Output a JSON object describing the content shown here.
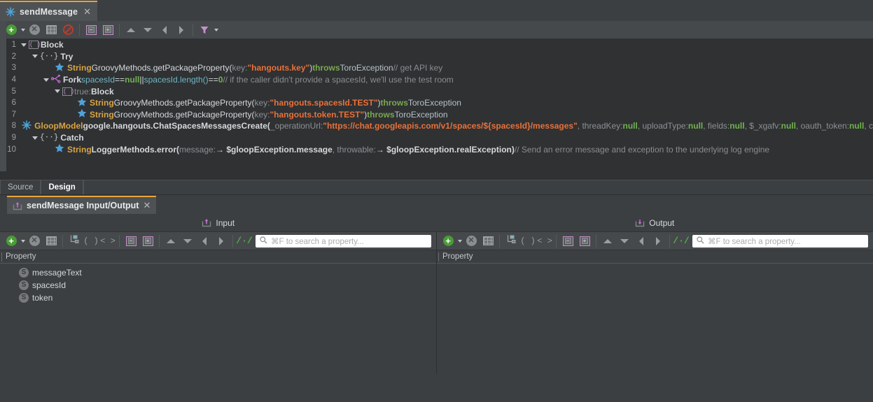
{
  "editor_tab": {
    "title": "sendMessage",
    "icon": "splat-icon",
    "close": "✕"
  },
  "top_toolbar": {
    "buttons": [
      {
        "name": "add-node-button",
        "icon": "green-plus-circle",
        "label": "+"
      },
      {
        "name": "add-node-dropdown",
        "icon": "caret-down-icon"
      },
      {
        "name": "delete-node-button",
        "icon": "grey-x-circle",
        "label": "✕"
      },
      {
        "name": "grid-view-button",
        "icon": "grid-icon"
      },
      {
        "name": "disable-node-button",
        "icon": "ban-icon"
      },
      {
        "name": "collapse-all-button",
        "icon": "collapse-box-icon",
        "label": "−"
      },
      {
        "name": "expand-all-button",
        "icon": "expand-box-icon",
        "label": "+"
      },
      {
        "name": "move-up-button",
        "icon": "triangle-up-icon"
      },
      {
        "name": "move-down-button",
        "icon": "triangle-down-icon"
      },
      {
        "name": "move-left-button",
        "icon": "triangle-left-icon"
      },
      {
        "name": "move-right-button",
        "icon": "triangle-right-icon"
      },
      {
        "name": "filter-button",
        "icon": "funnel-icon"
      },
      {
        "name": "filter-dropdown",
        "icon": "caret-down-icon"
      }
    ]
  },
  "code": {
    "lines": [
      {
        "num": "1",
        "indent": 0,
        "arrow": true,
        "icon": "block-bracket-icon",
        "tokens": [
          {
            "text": "Block",
            "cls": "id bold"
          }
        ]
      },
      {
        "num": "2",
        "indent": 1,
        "arrow": true,
        "icon": "braces-icon",
        "tokens": [
          {
            "text": "Try",
            "cls": "id bold"
          }
        ]
      },
      {
        "num": "3",
        "indent": 3,
        "arrow": false,
        "icon": "star-icon",
        "tokens": [
          {
            "text": "String ",
            "cls": "kw-type bold"
          },
          {
            "text": "GroovyMethods.getPackageProperty(",
            "cls": "id"
          },
          {
            "text": " key:",
            "cls": "param"
          },
          {
            "text": " \"hangouts.key\"",
            "cls": "str bold"
          },
          {
            "text": " )",
            "cls": "id"
          },
          {
            "text": " throws",
            "cls": "kw-throws bold"
          },
          {
            "text": " ToroException",
            "cls": "exc"
          },
          {
            "text": " // get API key",
            "cls": "cmt"
          }
        ]
      },
      {
        "num": "4",
        "indent": 2,
        "arrow": true,
        "icon": "fork-icon",
        "tokens": [
          {
            "text": "Fork ",
            "cls": "id bold"
          },
          {
            "text": "spacesId",
            "cls": "cond"
          },
          {
            "text": " == ",
            "cls": "id"
          },
          {
            "text": "null",
            "cls": "nullv bold"
          },
          {
            "text": " || ",
            "cls": "id"
          },
          {
            "text": "spacesId.length()",
            "cls": "cond"
          },
          {
            "text": " == ",
            "cls": "id"
          },
          {
            "text": "0",
            "cls": "nullv bold"
          },
          {
            "text": " // if the caller didn't provide a spacesId, we'll use the test room",
            "cls": "cmt"
          }
        ]
      },
      {
        "num": "5",
        "indent": 3,
        "arrow": true,
        "icon": "block-bracket-icon",
        "tokens": [
          {
            "text": "true: ",
            "cls": "cmt"
          },
          {
            "text": "Block",
            "cls": "id bold"
          }
        ]
      },
      {
        "num": "6",
        "indent": 5,
        "arrow": false,
        "icon": "star-icon",
        "tokens": [
          {
            "text": "String ",
            "cls": "kw-type bold"
          },
          {
            "text": "GroovyMethods.getPackageProperty(",
            "cls": "id"
          },
          {
            "text": " key:",
            "cls": "param"
          },
          {
            "text": " \"hangouts.spacesId.TEST\"",
            "cls": "str bold"
          },
          {
            "text": " )",
            "cls": "id"
          },
          {
            "text": " throws",
            "cls": "kw-throws bold"
          },
          {
            "text": " ToroException",
            "cls": "exc"
          }
        ]
      },
      {
        "num": "7",
        "indent": 5,
        "arrow": false,
        "icon": "star-icon",
        "tokens": [
          {
            "text": "String ",
            "cls": "kw-type bold"
          },
          {
            "text": "GroovyMethods.getPackageProperty(",
            "cls": "id"
          },
          {
            "text": " key:",
            "cls": "param"
          },
          {
            "text": " \"hangouts.token.TEST\"",
            "cls": "str bold"
          },
          {
            "text": " )",
            "cls": "id"
          },
          {
            "text": " throws",
            "cls": "kw-throws bold"
          },
          {
            "text": " ToroException",
            "cls": "exc"
          }
        ]
      },
      {
        "num": "8",
        "indent": 1,
        "arrow": false,
        "icon": "splat-icon",
        "tokens": [
          {
            "text": "GloopModel ",
            "cls": "kw-type bold"
          },
          {
            "text": "google.hangouts.ChatSpacesMessagesCreate(",
            "cls": "id bold"
          },
          {
            "text": " _operationUrl:",
            "cls": "param"
          },
          {
            "text": " \"https://chat.googleapis.com/v1/spaces/${spacesId}/messages\"",
            "cls": "str bold"
          },
          {
            "text": ", threadKey:",
            "cls": "param"
          },
          {
            "text": " null",
            "cls": "nullv bold"
          },
          {
            "text": ", uploadType:",
            "cls": "param"
          },
          {
            "text": " null",
            "cls": "nullv bold"
          },
          {
            "text": ", fields:",
            "cls": "param"
          },
          {
            "text": " null",
            "cls": "nullv bold"
          },
          {
            "text": ", $_xgafv:",
            "cls": "param"
          },
          {
            "text": " null",
            "cls": "nullv bold"
          },
          {
            "text": ", oauth_token:",
            "cls": "param"
          },
          {
            "text": " null",
            "cls": "nullv bold"
          },
          {
            "text": ", c",
            "cls": "param"
          }
        ]
      },
      {
        "num": "9",
        "indent": 1,
        "arrow": true,
        "icon": "braces-icon",
        "tokens": [
          {
            "text": "Catch",
            "cls": "id bold"
          }
        ]
      },
      {
        "num": "10",
        "indent": 3,
        "arrow": false,
        "icon": "star-icon",
        "tokens": [
          {
            "text": "String ",
            "cls": "kw-type bold"
          },
          {
            "text": "LoggerMethods.error(",
            "cls": "id bold"
          },
          {
            "text": " message:",
            "cls": "param"
          },
          {
            "text": " → $gloopException.message",
            "cls": "id bold"
          },
          {
            "text": ", throwable:",
            "cls": "param"
          },
          {
            "text": " → $gloopException.realException",
            "cls": "id bold"
          },
          {
            "text": " )",
            "cls": "id bold"
          },
          {
            "text": " // Send an error message and exception to the underlying log engine",
            "cls": "cmt"
          }
        ]
      }
    ]
  },
  "source_design": {
    "source_label": "Source",
    "design_label": "Design",
    "active": "Design"
  },
  "io_tab": {
    "title": "sendMessage Input/Output",
    "icon": "input-output-icon",
    "close": "✕"
  },
  "io_header": {
    "input_label": "Input",
    "output_label": "Output",
    "input_icon": "input-arrow-icon",
    "output_icon": "output-arrow-icon"
  },
  "io_toolbar": {
    "buttons": [
      {
        "name": "add-property-button",
        "icon": "green-plus-circle",
        "label": "+"
      },
      {
        "name": "add-property-dropdown",
        "icon": "caret-down-icon"
      },
      {
        "name": "delete-property-button",
        "icon": "grey-x-circle",
        "label": "✕"
      },
      {
        "name": "grid-view-button",
        "icon": "grid-icon"
      },
      {
        "name": "model-tree-button",
        "icon": "model-tree-icon"
      },
      {
        "name": "parens-button",
        "icon": "parentheses-icon",
        "label": "( )"
      },
      {
        "name": "angle-brackets-button",
        "icon": "angle-brackets-icon",
        "label": "< >"
      },
      {
        "name": "collapse-all-button",
        "icon": "collapse-box-icon",
        "label": "−"
      },
      {
        "name": "expand-all-button",
        "icon": "expand-box-icon",
        "label": "+"
      },
      {
        "name": "move-up-button",
        "icon": "triangle-up-icon"
      },
      {
        "name": "move-down-button",
        "icon": "triangle-down-icon"
      },
      {
        "name": "move-left-button",
        "icon": "triangle-left-icon"
      },
      {
        "name": "move-right-button",
        "icon": "triangle-right-icon"
      },
      {
        "name": "toggle-comments-button",
        "icon": "double-slash-icon",
        "label": "/·/"
      }
    ]
  },
  "input_panel": {
    "search_placeholder": "⌘F to search a property...",
    "search_value": "",
    "search_icon": "search-icon",
    "column_header": "Property",
    "rows": [
      {
        "icon": "string-type-icon",
        "icon_letter": "S",
        "name": "messageText"
      },
      {
        "icon": "string-type-icon",
        "icon_letter": "S",
        "name": "spacesId"
      },
      {
        "icon": "string-type-icon",
        "icon_letter": "S",
        "name": "token"
      }
    ]
  },
  "output_panel": {
    "search_placeholder": "⌘F to search a property...",
    "search_value": "",
    "search_icon": "search-icon",
    "column_header": "Property",
    "rows": []
  },
  "colors": {
    "accent": "#e8a33d",
    "background": "#3c3f41",
    "editor_background": "#2f3133",
    "toolbar": "#46494b",
    "string": "#e8713a",
    "type": "#d9a443",
    "keyword": "#7aa84f",
    "null": "#72b34e",
    "comment": "#8a8e90",
    "condition": "#6fb7c4",
    "star": "#4ea3d8",
    "green_add": "#4a9c36",
    "pink_border": "#c98fd0"
  }
}
